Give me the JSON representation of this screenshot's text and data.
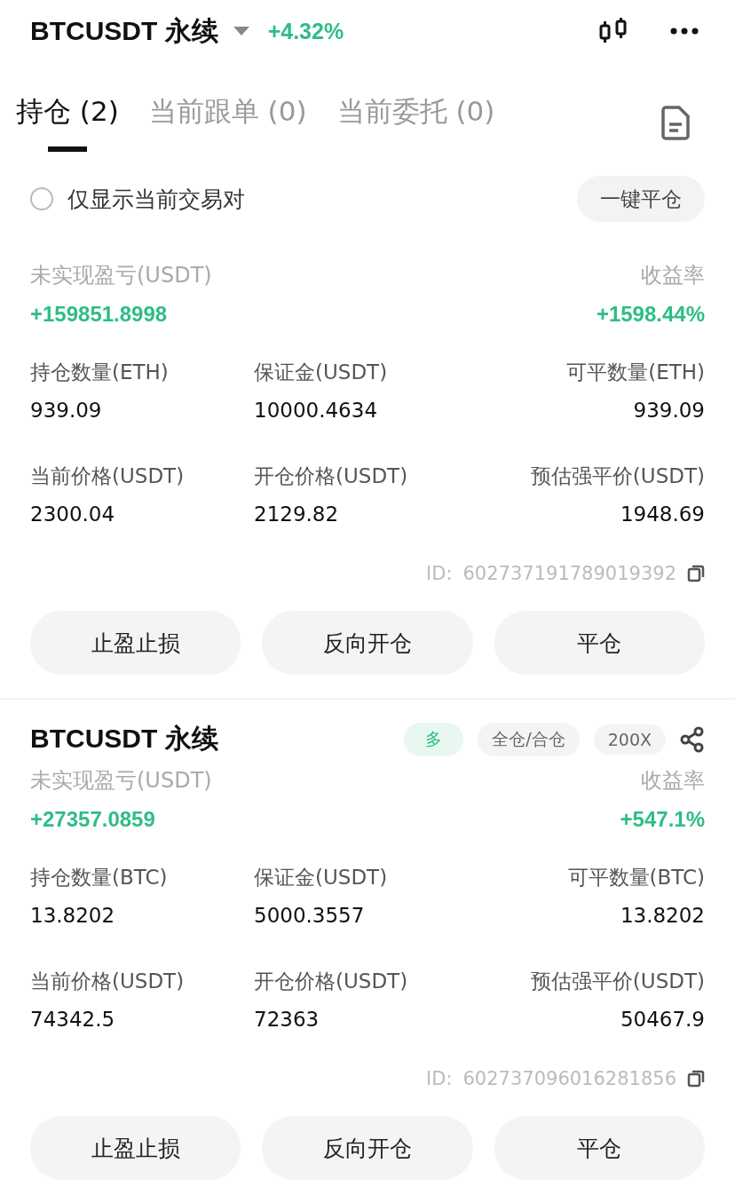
{
  "header": {
    "symbol": "BTCUSDT 永续",
    "change": "+4.32%"
  },
  "tabs": [
    {
      "label": "持仓 (2)",
      "selected": true
    },
    {
      "label": "当前跟单 (0)",
      "selected": false
    },
    {
      "label": "当前委托 (0)",
      "selected": false
    }
  ],
  "filter": {
    "label": "仅显示当前交易对",
    "checked": false,
    "close_all": "一键平仓"
  },
  "positions": [
    {
      "pnl_label": "未实现盈亏(USDT)",
      "pnl": "+159851.8998",
      "roe_label": "收益率",
      "roe": "+1598.44%",
      "stats": [
        {
          "label": "持仓数量(ETH)",
          "value": "939.09"
        },
        {
          "label": "保证金(USDT)",
          "value": "10000.4634"
        },
        {
          "label": "可平数量(ETH)",
          "value": "939.09"
        },
        {
          "label": "当前价格(USDT)",
          "value": "2300.04"
        },
        {
          "label": "开仓价格(USDT)",
          "value": "2129.82"
        },
        {
          "label": "预估强平价(USDT)",
          "value": "1948.69"
        }
      ],
      "id_label": "ID:",
      "id": "602737191789019392",
      "buttons": [
        "止盈止损",
        "反向开仓",
        "平仓"
      ]
    },
    {
      "title": "BTCUSDT 永续",
      "tags": [
        {
          "label": "多",
          "kind": "side"
        },
        {
          "label": "全仓/合仓",
          "kind": "plain"
        },
        {
          "label": "200X",
          "kind": "plain"
        }
      ],
      "pnl_label": "未实现盈亏(USDT)",
      "pnl": "+27357.0859",
      "roe_label": "收益率",
      "roe": "+547.1%",
      "stats": [
        {
          "label": "持仓数量(BTC)",
          "value": "13.8202"
        },
        {
          "label": "保证金(USDT)",
          "value": "5000.3557"
        },
        {
          "label": "可平数量(BTC)",
          "value": "13.8202"
        },
        {
          "label": "当前价格(USDT)",
          "value": "74342.5"
        },
        {
          "label": "开仓价格(USDT)",
          "value": "72363"
        },
        {
          "label": "预估强平价(USDT)",
          "value": "50467.9"
        }
      ],
      "id_label": "ID:",
      "id": "602737096016281856",
      "buttons": [
        "止盈止损",
        "反向开仓",
        "平仓"
      ]
    }
  ]
}
